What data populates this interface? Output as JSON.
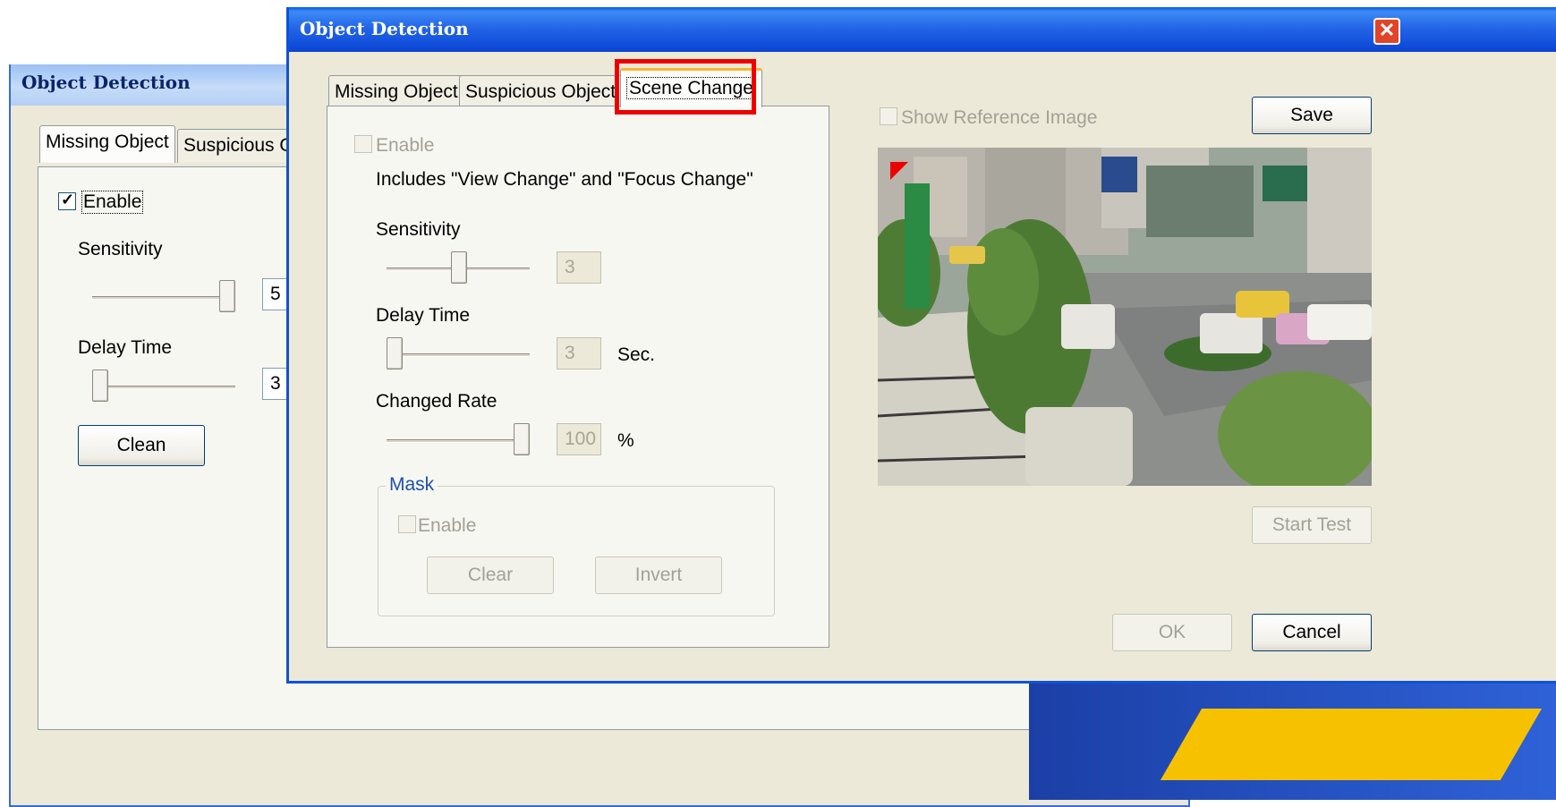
{
  "background_dialog": {
    "title": "Object Detection",
    "tabs": [
      "Missing Object",
      "Suspicious O"
    ],
    "enable_label": "Enable",
    "enable_checked": true,
    "sensitivity_label": "Sensitivity",
    "sensitivity_value": "5",
    "delay_label": "Delay Time",
    "delay_value": "3",
    "clean_button": "Clean"
  },
  "main_dialog": {
    "title": "Object Detection",
    "tabs": [
      "Missing Object",
      "Suspicious Object",
      "Scene Change"
    ],
    "active_tab": "Scene Change",
    "enable_label": "Enable",
    "description": "Includes \"View Change\" and \"Focus Change\"",
    "sensitivity": {
      "label": "Sensitivity",
      "value": "3"
    },
    "delay_time": {
      "label": "Delay  Time",
      "value": "3",
      "unit": "Sec."
    },
    "changed_rate": {
      "label": "Changed Rate",
      "value": "100",
      "unit": "%"
    },
    "mask": {
      "label": "Mask",
      "enable_label": "Enable",
      "clear_button": "Clear",
      "invert_button": "Invert"
    },
    "show_reference_label": "Show Reference Image",
    "save_button": "Save",
    "start_test_button": "Start Test",
    "ok_button": "OK",
    "cancel_button": "Cancel",
    "close_glyph": "✕"
  },
  "colors": {
    "highlight": "#ee0000",
    "titlebar_active": "#0d4ad8",
    "dialog_bg": "#ece9d8"
  }
}
